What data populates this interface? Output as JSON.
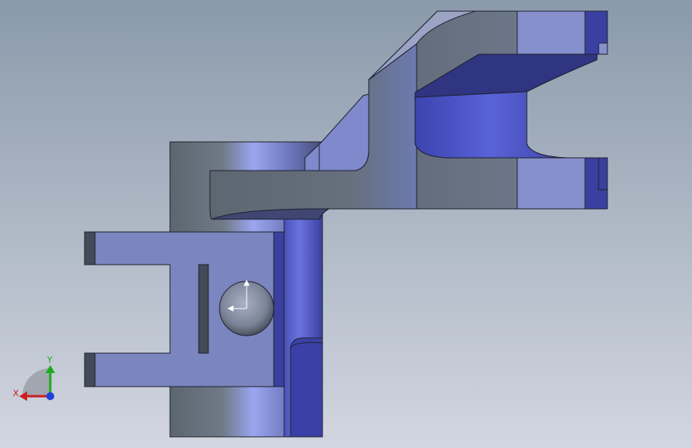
{
  "viewport": {
    "background_top": "#8a9aab",
    "background_bottom": "#d2d6e0",
    "part_color_light": "#8f96d8",
    "part_color_mid": "#6f78b4",
    "part_color_dark": "#3a3f9a",
    "steel_color": "#5e6a78"
  },
  "triad": {
    "x_label": "X",
    "y_label": "Y",
    "x_color": "#cc2020",
    "y_color": "#20aa20",
    "z_color": "#2040dd"
  }
}
